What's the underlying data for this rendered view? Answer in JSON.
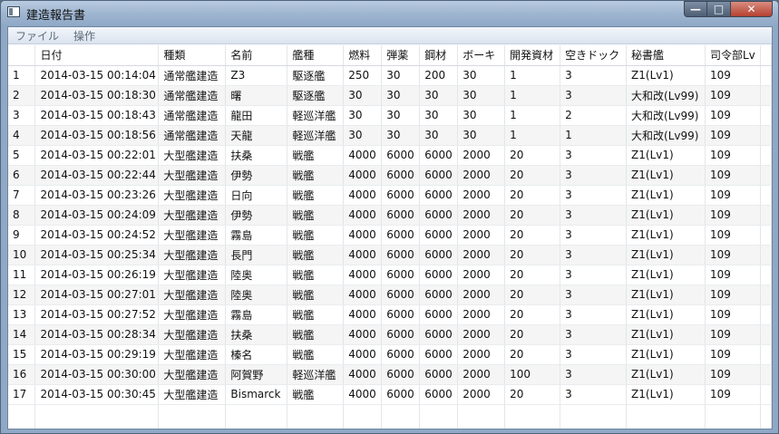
{
  "window": {
    "title": "建造報告書"
  },
  "menu": {
    "file": "ファイル",
    "operation": "操作"
  },
  "table": {
    "columns": [
      "",
      "日付",
      "種類",
      "名前",
      "艦種",
      "燃料",
      "弾薬",
      "鋼材",
      "ボーキ",
      "開発資材",
      "空きドック",
      "秘書艦",
      "司令部Lv"
    ],
    "rows": [
      [
        "1",
        "2014-03-15 00:14:04",
        "通常艦建造",
        "Z3",
        "駆逐艦",
        "250",
        "30",
        "200",
        "30",
        "1",
        "3",
        "Z1(Lv1)",
        "109"
      ],
      [
        "2",
        "2014-03-15 00:18:30",
        "通常艦建造",
        "曙",
        "駆逐艦",
        "30",
        "30",
        "30",
        "30",
        "1",
        "3",
        "大和改(Lv99)",
        "109"
      ],
      [
        "3",
        "2014-03-15 00:18:43",
        "通常艦建造",
        "龍田",
        "軽巡洋艦",
        "30",
        "30",
        "30",
        "30",
        "1",
        "2",
        "大和改(Lv99)",
        "109"
      ],
      [
        "4",
        "2014-03-15 00:18:56",
        "通常艦建造",
        "天龍",
        "軽巡洋艦",
        "30",
        "30",
        "30",
        "30",
        "1",
        "1",
        "大和改(Lv99)",
        "109"
      ],
      [
        "5",
        "2014-03-15 00:22:01",
        "大型艦建造",
        "扶桑",
        "戦艦",
        "4000",
        "6000",
        "6000",
        "2000",
        "20",
        "3",
        "Z1(Lv1)",
        "109"
      ],
      [
        "6",
        "2014-03-15 00:22:44",
        "大型艦建造",
        "伊勢",
        "戦艦",
        "4000",
        "6000",
        "6000",
        "2000",
        "20",
        "3",
        "Z1(Lv1)",
        "109"
      ],
      [
        "7",
        "2014-03-15 00:23:26",
        "大型艦建造",
        "日向",
        "戦艦",
        "4000",
        "6000",
        "6000",
        "2000",
        "20",
        "3",
        "Z1(Lv1)",
        "109"
      ],
      [
        "8",
        "2014-03-15 00:24:09",
        "大型艦建造",
        "伊勢",
        "戦艦",
        "4000",
        "6000",
        "6000",
        "2000",
        "20",
        "3",
        "Z1(Lv1)",
        "109"
      ],
      [
        "9",
        "2014-03-15 00:24:52",
        "大型艦建造",
        "霧島",
        "戦艦",
        "4000",
        "6000",
        "6000",
        "2000",
        "20",
        "3",
        "Z1(Lv1)",
        "109"
      ],
      [
        "10",
        "2014-03-15 00:25:34",
        "大型艦建造",
        "長門",
        "戦艦",
        "4000",
        "6000",
        "6000",
        "2000",
        "20",
        "3",
        "Z1(Lv1)",
        "109"
      ],
      [
        "11",
        "2014-03-15 00:26:19",
        "大型艦建造",
        "陸奥",
        "戦艦",
        "4000",
        "6000",
        "6000",
        "2000",
        "20",
        "3",
        "Z1(Lv1)",
        "109"
      ],
      [
        "12",
        "2014-03-15 00:27:01",
        "大型艦建造",
        "陸奥",
        "戦艦",
        "4000",
        "6000",
        "6000",
        "2000",
        "20",
        "3",
        "Z1(Lv1)",
        "109"
      ],
      [
        "13",
        "2014-03-15 00:27:52",
        "大型艦建造",
        "霧島",
        "戦艦",
        "4000",
        "6000",
        "6000",
        "2000",
        "20",
        "3",
        "Z1(Lv1)",
        "109"
      ],
      [
        "14",
        "2014-03-15 00:28:34",
        "大型艦建造",
        "扶桑",
        "戦艦",
        "4000",
        "6000",
        "6000",
        "2000",
        "20",
        "3",
        "Z1(Lv1)",
        "109"
      ],
      [
        "15",
        "2014-03-15 00:29:19",
        "大型艦建造",
        "榛名",
        "戦艦",
        "4000",
        "6000",
        "6000",
        "2000",
        "20",
        "3",
        "Z1(Lv1)",
        "109"
      ],
      [
        "16",
        "2014-03-15 00:30:00",
        "大型艦建造",
        "阿賀野",
        "軽巡洋艦",
        "4000",
        "6000",
        "6000",
        "2000",
        "100",
        "3",
        "Z1(Lv1)",
        "109"
      ],
      [
        "17",
        "2014-03-15 00:30:45",
        "大型艦建造",
        "Bismarck",
        "戦艦",
        "4000",
        "6000",
        "6000",
        "2000",
        "20",
        "3",
        "Z1(Lv1)",
        "109"
      ]
    ]
  }
}
